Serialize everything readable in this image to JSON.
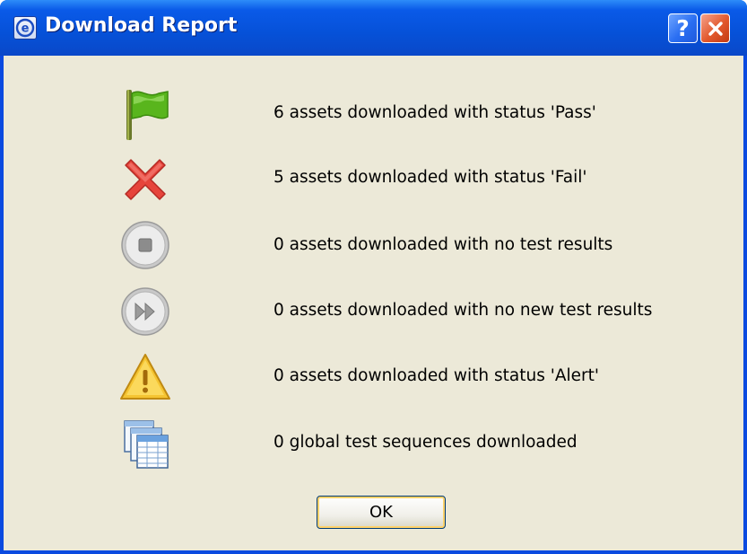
{
  "window": {
    "title": "Download Report",
    "help_label": "?",
    "app_icon": "e-circle-icon"
  },
  "rows": [
    {
      "icon": "green-flag-icon",
      "text": "6 assets downloaded with status 'Pass'"
    },
    {
      "icon": "red-x-icon",
      "text": "5 assets downloaded with status 'Fail'"
    },
    {
      "icon": "stop-circle-icon",
      "text": "0 assets downloaded with no test results"
    },
    {
      "icon": "fast-forward-circle-icon",
      "text": "0 assets downloaded with no new test results"
    },
    {
      "icon": "warning-triangle-icon",
      "text": "0 assets downloaded with status 'Alert'"
    },
    {
      "icon": "stacked-tables-icon",
      "text": "0 global test sequences downloaded"
    }
  ],
  "buttons": {
    "ok_label": "OK"
  },
  "colors": {
    "titlebar": "#0651d8",
    "client_bg": "#ece9d8",
    "close_button": "#e2582c",
    "pass_green": "#5fbf22",
    "fail_red": "#e8453c",
    "alert_yellow": "#f6c431"
  }
}
